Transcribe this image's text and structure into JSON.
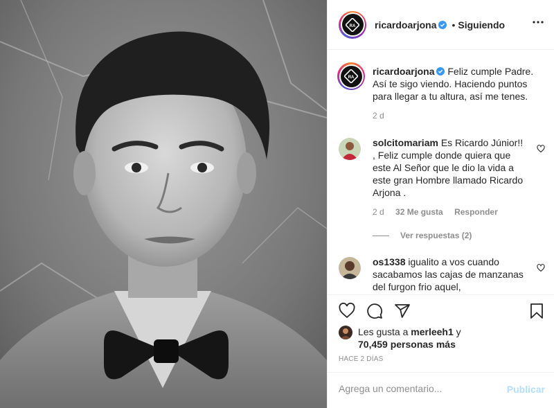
{
  "post": {
    "username": "ricardoarjona",
    "follow_status": "Siguiendo",
    "separator": "•",
    "more_icon": "more-options-icon",
    "verified_color": "#3897f0"
  },
  "caption": {
    "username": "ricardoarjona",
    "text": "Feliz cumple Padre. Así te sigo viendo. Haciendo puntos para llegar a tu altura, así me tenes.",
    "time": "2 d"
  },
  "comments": [
    {
      "username": "solcitomariam",
      "text": "Es Ricardo Júnior!! , Feliz cumple donde quiera que este Al Señor que le dio la vida a este gran Hombre llamado Ricardo Arjona .",
      "time": "2 d",
      "likes": "32 Me gusta",
      "reply": "Responder",
      "view_replies": "Ver respuestas (2)"
    },
    {
      "username": "os1338",
      "text": "igualito a vos cuando sacabamos las cajas de manzanas del furgon frio aquel,"
    }
  ],
  "likes": {
    "prefix": "Les gusta a",
    "user": "merleeh1",
    "joiner": "y",
    "count": "70,459 personas más"
  },
  "timestamp": "HACE 2 DÍAS",
  "add_comment": {
    "placeholder": "Agrega un comentario...",
    "publish": "Publicar"
  },
  "icons": [
    "heart-icon",
    "comment-icon",
    "share-icon",
    "bookmark-icon"
  ]
}
